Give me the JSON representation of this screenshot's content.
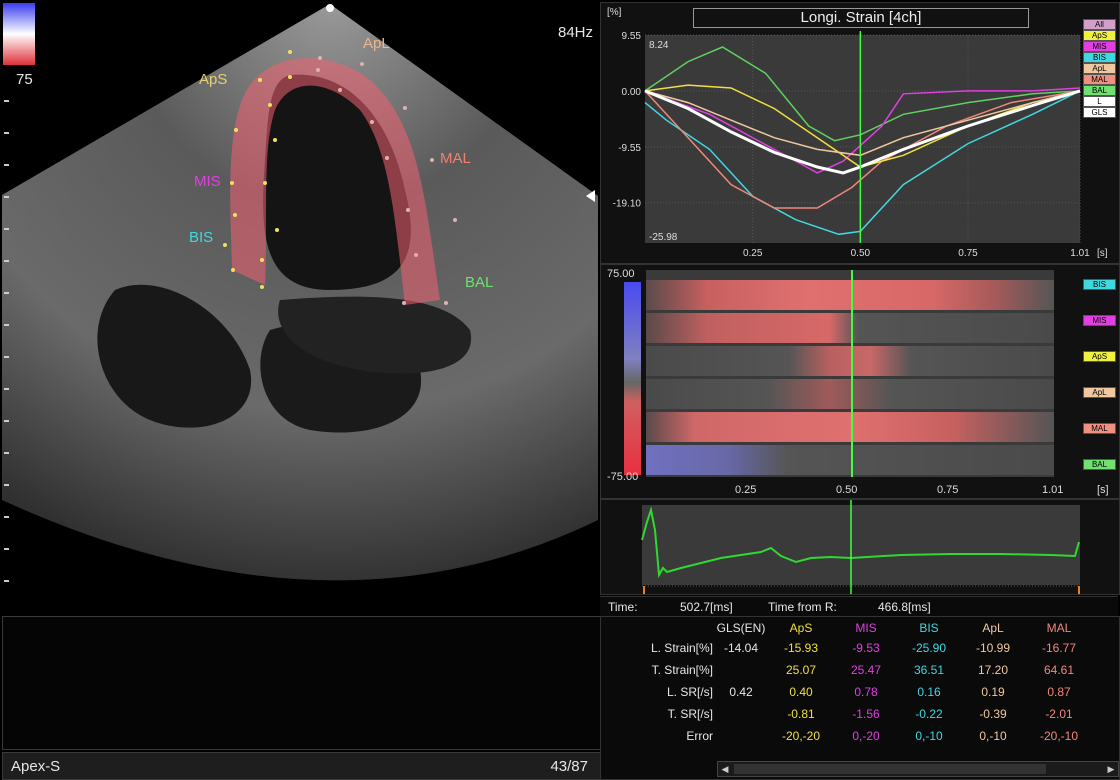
{
  "echo": {
    "fps": "84Hz",
    "colorbar_max": "75",
    "segments": [
      {
        "label": "ApL",
        "color": "#f0b48c"
      },
      {
        "label": "ApS",
        "color": "#e8d070"
      },
      {
        "label": "MAL",
        "color": "#f08070"
      },
      {
        "label": "MIS",
        "color": "#e040e0"
      },
      {
        "label": "BIS",
        "color": "#40d8e0"
      },
      {
        "label": "BAL",
        "color": "#70e070"
      }
    ]
  },
  "status": {
    "view": "Apex-S",
    "frame": "43/87"
  },
  "chart_data": [
    {
      "type": "line",
      "title": "Longi. Strain [4ch]",
      "ylabel": "[%]",
      "xlabel": "[s]",
      "y_ticks": [
        "9.55",
        "0.00",
        "-9.55",
        "-19.10"
      ],
      "x_ticks": [
        "0.25",
        "0.50",
        "0.75",
        "1.01"
      ],
      "ylim": [
        -25.98,
        9.55
      ],
      "xlim": [
        0.0,
        1.01
      ],
      "corner_labels": {
        "top": "8.24",
        "bottom": "-25.98"
      },
      "cursor_x": 0.5,
      "legend": [
        "All",
        "ApS",
        "MIS",
        "BIS",
        "ApL",
        "MAL",
        "BAL",
        "L",
        "GLS"
      ],
      "legend_colors": [
        "#d0a0c8",
        "#f0f040",
        "#e040e0",
        "#40d8e0",
        "#f0c8a0",
        "#f09080",
        "#70e070",
        "#ffffff",
        "#ffffff"
      ],
      "series": [
        {
          "name": "BAL",
          "color": "#60d060",
          "x": [
            0.0,
            0.1,
            0.18,
            0.28,
            0.38,
            0.44,
            0.5,
            0.6,
            0.75,
            0.9,
            1.01
          ],
          "y": [
            0,
            5,
            7.5,
            3,
            -6,
            -8.5,
            -7.5,
            -4,
            -2,
            -0.5,
            0
          ]
        },
        {
          "name": "BIS",
          "color": "#40d8e0",
          "x": [
            0.0,
            0.05,
            0.15,
            0.25,
            0.35,
            0.45,
            0.5,
            0.6,
            0.75,
            0.9,
            1.01
          ],
          "y": [
            -2,
            -5,
            -10,
            -18,
            -22,
            -24.5,
            -24,
            -16,
            -9,
            -4,
            0
          ]
        },
        {
          "name": "MAL",
          "color": "#f08878",
          "x": [
            0.0,
            0.1,
            0.2,
            0.3,
            0.4,
            0.48,
            0.55,
            0.7,
            0.85,
            1.01
          ],
          "y": [
            0,
            -8,
            -16,
            -20,
            -20,
            -16.5,
            -12,
            -6,
            -2,
            0
          ]
        },
        {
          "name": "MIS",
          "color": "#e040e0",
          "x": [
            0.0,
            0.15,
            0.3,
            0.4,
            0.46,
            0.55,
            0.6,
            0.75,
            0.9,
            1.01
          ],
          "y": [
            0,
            -4,
            -10,
            -14,
            -12,
            -6,
            -0.5,
            0,
            0,
            0.5
          ]
        },
        {
          "name": "ApS",
          "color": "#f0e040",
          "x": [
            0.0,
            0.1,
            0.2,
            0.3,
            0.4,
            0.5,
            0.6,
            0.75,
            0.9,
            1.01
          ],
          "y": [
            0,
            1,
            0.5,
            -3,
            -8,
            -13,
            -11,
            -6,
            -2,
            0
          ]
        },
        {
          "name": "ApL",
          "color": "#f0c8a0",
          "x": [
            0.0,
            0.1,
            0.2,
            0.3,
            0.4,
            0.5,
            0.6,
            0.75,
            0.9,
            1.01
          ],
          "y": [
            0,
            -2,
            -5,
            -8,
            -10,
            -11,
            -8,
            -5,
            -2,
            0
          ]
        },
        {
          "name": "GLS",
          "color": "#ffffff",
          "x": [
            0.0,
            0.1,
            0.2,
            0.3,
            0.4,
            0.46,
            0.5,
            0.6,
            0.75,
            0.9,
            1.01
          ],
          "y": [
            0,
            -3,
            -7,
            -10.5,
            -13,
            -14,
            -13,
            -10,
            -6,
            -2.5,
            0
          ]
        }
      ]
    },
    {
      "type": "heatmap",
      "y_ticks": [
        "75.00",
        "-75.00"
      ],
      "x_ticks": [
        "0.25",
        "0.50",
        "0.75",
        "1.01"
      ],
      "xlabel": "[s]",
      "rows": [
        "BIS",
        "MIS",
        "ApS",
        "ApL",
        "MAL",
        "BAL"
      ],
      "row_colors": [
        "#40d8e0",
        "#e040e0",
        "#f0f040",
        "#f0c8a0",
        "#f09080",
        "#70e070"
      ]
    }
  ],
  "time_row": {
    "time_label": "Time:",
    "time_value": "502.7[ms]",
    "from_r_label": "Time from R:",
    "from_r_value": "466.8[ms]"
  },
  "table": {
    "columns": [
      {
        "label": "GLS(EN)",
        "color": "#e6e6e6"
      },
      {
        "label": "ApS",
        "color": "#f0e040"
      },
      {
        "label": "MIS",
        "color": "#e040e0"
      },
      {
        "label": "BIS",
        "color": "#40d8e0"
      },
      {
        "label": "ApL",
        "color": "#f0c8a0"
      },
      {
        "label": "MAL",
        "color": "#f08878"
      }
    ],
    "rows": [
      {
        "label": "L. Strain[%]",
        "values": [
          "-14.04",
          "-15.93",
          "-9.53",
          "-25.90",
          "-10.99",
          "-16.77"
        ]
      },
      {
        "label": "T. Strain[%]",
        "values": [
          "",
          "25.07",
          "25.47",
          "36.51",
          "17.20",
          "64.61"
        ]
      },
      {
        "label": "L. SR[/s]",
        "values": [
          "0.42",
          "0.40",
          "0.78",
          "0.16",
          "0.19",
          "0.87"
        ]
      },
      {
        "label": "T. SR[/s]",
        "values": [
          "",
          "-0.81",
          "-1.56",
          "-0.22",
          "-0.39",
          "-2.01"
        ]
      },
      {
        "label": "Error",
        "values": [
          "",
          "-20,-20",
          "0,-20",
          "0,-10",
          "0,-10",
          "-20,-10"
        ]
      }
    ]
  }
}
